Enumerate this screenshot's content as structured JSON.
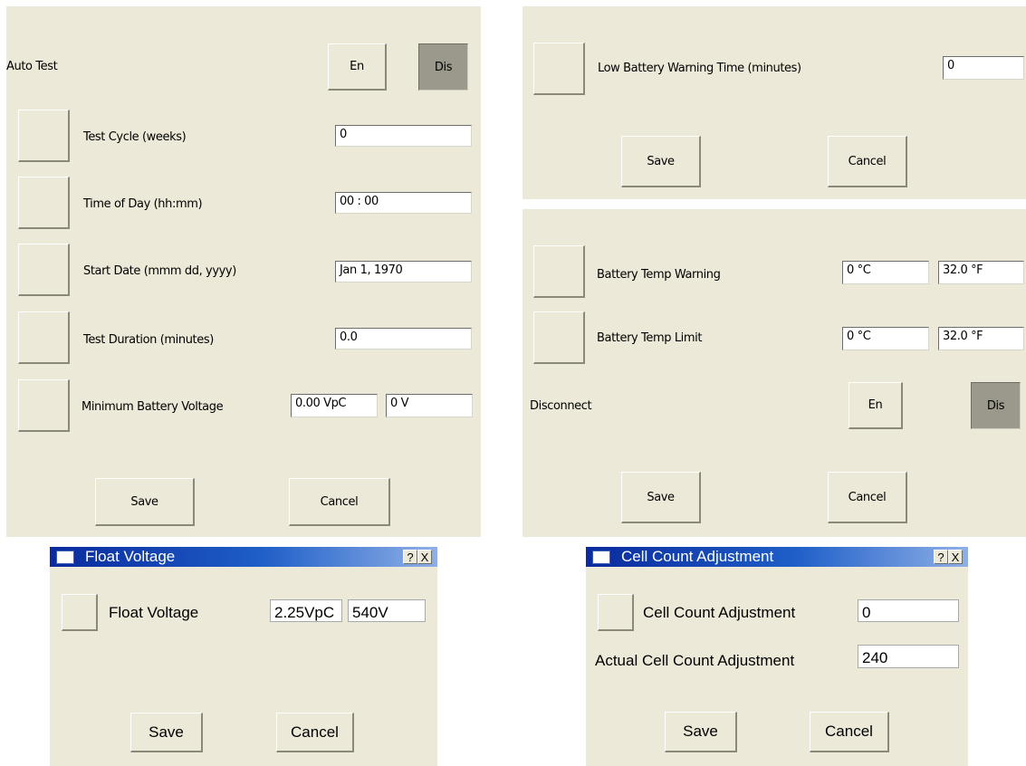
{
  "auto_test_panel": {
    "title": "Auto Test",
    "en_label": "En",
    "dis_label": "Dis",
    "rows": [
      {
        "label": "Test Cycle (weeks)",
        "value": "0"
      },
      {
        "label": "Time of Day (hh:mm)",
        "value": "00 : 00"
      },
      {
        "label": "Start Date (mmm dd, yyyy)",
        "value": "Jan  1, 1970"
      },
      {
        "label": "Test Duration (minutes)",
        "value": "0.0"
      }
    ],
    "min_voltage": {
      "label": "Minimum Battery Voltage",
      "vpc": "0.00 VpC",
      "v": "0 V"
    },
    "save_label": "Save",
    "cancel_label": "Cancel"
  },
  "low_battery_panel": {
    "label": "Low Battery Warning Time (minutes)",
    "value": "0",
    "save_label": "Save",
    "cancel_label": "Cancel"
  },
  "battery_temp_panel": {
    "warning": {
      "label": "Battery Temp Warning",
      "c": "0 °C",
      "f": "32.0 °F"
    },
    "limit": {
      "label": "Battery Temp Limit",
      "c": "0 °C",
      "f": "32.0 °F"
    },
    "disconnect_label": "Disconnect",
    "en_label": "En",
    "dis_label": "Dis",
    "save_label": "Save",
    "cancel_label": "Cancel"
  },
  "float_voltage_dialog": {
    "title": "Float Voltage",
    "help": "?",
    "close": "X",
    "label": "Float Voltage",
    "vpc": "2.25VpC",
    "v": "540V",
    "save_label": "Save",
    "cancel_label": "Cancel"
  },
  "cell_count_dialog": {
    "title": "Cell Count Adjustment",
    "help": "?",
    "close": "X",
    "label": "Cell Count Adjustment",
    "value": "0",
    "actual_label": "Actual Cell Count Adjustment",
    "actual_value": "240",
    "save_label": "Save",
    "cancel_label": "Cancel"
  },
  "colors": {
    "panel_bg": "#ece9d8",
    "pressed_bg": "#9a998c",
    "titlebar": "#0a2a9e"
  }
}
